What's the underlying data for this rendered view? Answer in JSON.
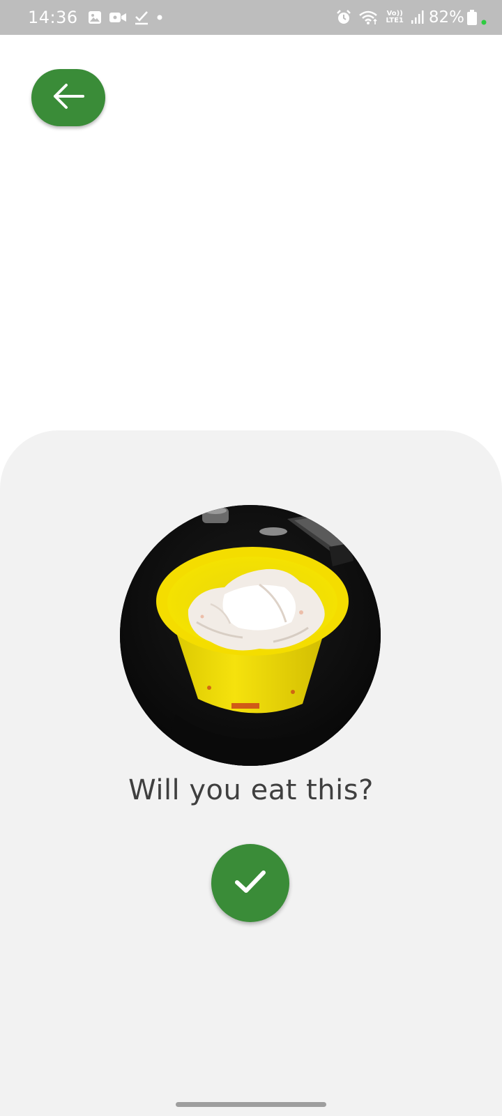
{
  "status_bar": {
    "time": "14:36",
    "battery_percent": "82%",
    "lte_top": "Vo))",
    "lte_bottom": "LTE1",
    "left_icons": [
      "gallery-icon",
      "video-call-icon",
      "checkmark-icon",
      "dot-icon"
    ],
    "right_icons": [
      "alarm-icon",
      "wifi-icon",
      "volte-lte-icon",
      "signal-icon",
      "battery-icon",
      "privacy-dot-icon"
    ]
  },
  "header": {
    "back_icon": "arrow-left-icon"
  },
  "main": {
    "question": "Will you eat this?",
    "confirm_icon": "check-icon",
    "photo": "food-photo"
  },
  "colors": {
    "accent": "#3a8c38",
    "status_bar": "#bdbdbd",
    "sheet": "#f2f2f2",
    "text": "#3f3f3f"
  }
}
